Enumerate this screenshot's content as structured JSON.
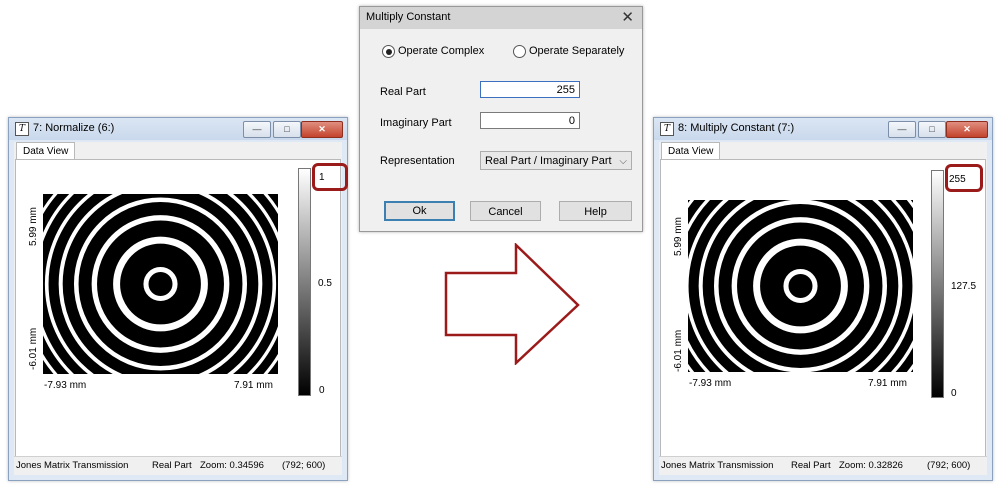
{
  "left_window": {
    "title": "7: Normalize (6:)",
    "tab": "Data View",
    "y_top_label": "5.99 mm",
    "y_bottom_label": "-6.01 mm",
    "x_left_label": "-7.93 mm",
    "x_right_label": "7.91 mm",
    "colorbar_max": "1",
    "colorbar_mid": "0.5",
    "colorbar_min": "0",
    "status": {
      "type": "Jones Matrix Transmission",
      "part": "Real Part",
      "zoom": "Zoom: 0.34596",
      "size": "(792; 600)"
    }
  },
  "right_window": {
    "title": "8: Multiply Constant (7:)",
    "tab": "Data View",
    "y_top_label": "5.99 mm",
    "y_bottom_label": "-6.01 mm",
    "x_left_label": "-7.93 mm",
    "x_right_label": "7.91 mm",
    "colorbar_max": "255",
    "colorbar_mid": "127.5",
    "colorbar_min": "0",
    "status": {
      "type": "Jones Matrix Transmission",
      "part": "Real Part",
      "zoom": "Zoom: 0.32826",
      "size": "(792; 600)"
    }
  },
  "dialog": {
    "title": "Multiply Constant",
    "close_glyph": "✕",
    "radio_complex": "Operate Complex",
    "radio_separately": "Operate Separately",
    "real_part_label": "Real Part",
    "real_part_value": "255",
    "imag_part_label": "Imaginary Part",
    "imag_part_value": "0",
    "representation_label": "Representation",
    "representation_value": "Real Part / Imaginary Part",
    "ok": "Ok",
    "cancel": "Cancel",
    "help": "Help"
  },
  "window_controls": {
    "minimize": "—",
    "maximize": "□",
    "close": "✕"
  },
  "colors": {
    "highlight": "#9b1b1b",
    "arrow": "#9b1b1b"
  }
}
